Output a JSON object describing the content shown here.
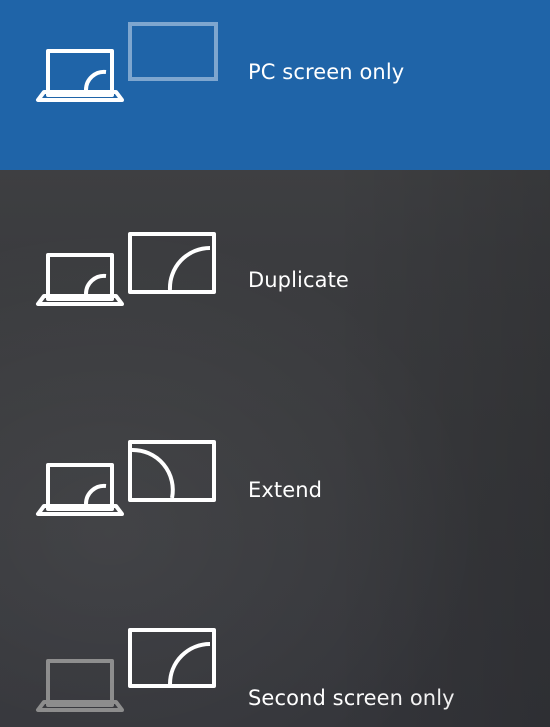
{
  "project_menu": {
    "options": [
      {
        "label": "PC screen only",
        "icon": "pc-screen-only-icon",
        "selected": true
      },
      {
        "label": "Duplicate",
        "icon": "duplicate-icon",
        "selected": false
      },
      {
        "label": "Extend",
        "icon": "extend-icon",
        "selected": false
      },
      {
        "label": "Second screen only",
        "icon": "second-screen-only-icon",
        "selected": false
      }
    ]
  },
  "colors": {
    "selected_background": "#1f64a8",
    "panel_background": "#3a3b3e",
    "text": "#ffffff",
    "icon_active": "#ffffff",
    "icon_dim": "#8a8a8a",
    "icon_dim_on_blue": "#7ea6cf"
  }
}
